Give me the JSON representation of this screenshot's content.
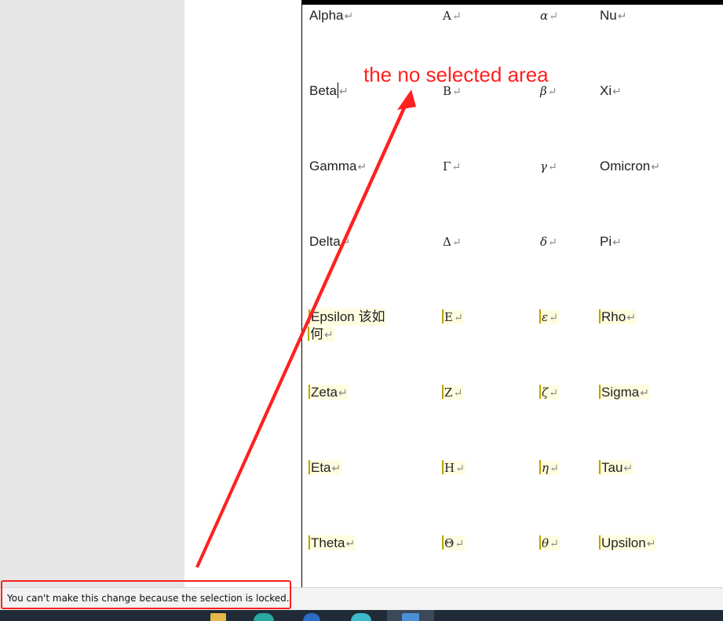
{
  "table": {
    "rows": [
      {
        "name": "Alpha",
        "upper": "Α",
        "lower": "α",
        "name2": "Nu",
        "locked": false
      },
      {
        "name": "Beta",
        "upper": "Β",
        "lower": "β",
        "name2": "Xi",
        "locked": false
      },
      {
        "name": "Gamma",
        "upper": "Γ",
        "lower": "γ",
        "name2": "Omicron",
        "locked": false
      },
      {
        "name": "Delta",
        "upper": "Δ",
        "lower": "δ",
        "name2": "Pi",
        "locked": false
      },
      {
        "name": "Epsilon 该如",
        "name_cont": "何",
        "upper": "Ε",
        "lower": "ε",
        "name2": "Rho",
        "locked": true
      },
      {
        "name": "Zeta",
        "upper": "Ζ",
        "lower": "ζ",
        "name2": "Sigma",
        "locked": true
      },
      {
        "name": "Eta",
        "upper": "Η",
        "lower": "η",
        "name2": "Tau",
        "locked": true
      },
      {
        "name": "Theta",
        "upper": "Θ",
        "lower": "θ",
        "name2": "Upsilon",
        "locked": true
      }
    ],
    "paragraph_mark": "↵"
  },
  "annotation": {
    "label": "the no selected area",
    "color": "#ff2020"
  },
  "status_bar": {
    "message": "You can't make this change because the selection is locked."
  },
  "colors": {
    "locked_highlight": "#fffde0",
    "locked_bracket": "#b8a600",
    "annotation_red": "#ff2020"
  }
}
